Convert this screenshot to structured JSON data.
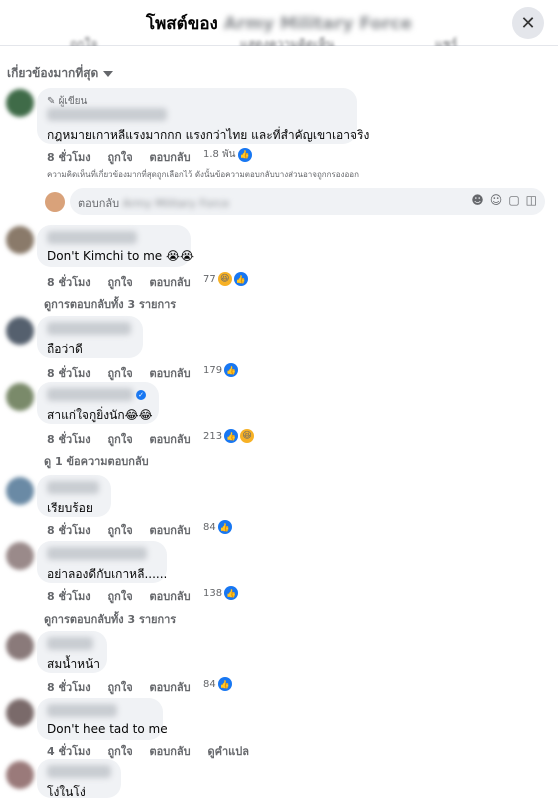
{
  "header": {
    "title": "โพสต์ของ",
    "page_name": "Army Military Force",
    "close_icon": "close-icon"
  },
  "actions": [
    "ถูกใจ",
    "แสดงความคิดเห็น",
    "แชร์"
  ],
  "sort": {
    "label": "เกี่ยวข้องมากที่สุด"
  },
  "top_comment": {
    "author_badge": "ผู้เขียน",
    "text": "กฎหมายเกาหลีแรงมากกก แรงกว่าไทย และที่สำคัญเขาเอาจริง",
    "time": "8 ชั่วโมง",
    "like": "ถูกใจ",
    "reply": "ตอบกลับ",
    "reactions": "1.8 พัน"
  },
  "note": "ความคิดเห็นที่เกี่ยวข้องมากที่สุดถูกเลือกไว้ ดังนั้นข้อความตอบกลับบางส่วนอาจถูกกรองออก",
  "reply_box": {
    "placeholder": "ตอบกลับ",
    "target": "Army Military Force"
  },
  "comments": [
    {
      "text": "Don't Kimchi to me 😭😭",
      "time": "8 ชั่วโมง",
      "like": "ถูกใจ",
      "reply": "ตอบกลับ",
      "reactions": "77",
      "view_replies": "ดูการตอบกลับทั้ง 3 รายการ"
    },
    {
      "text": "ถือว่าดี",
      "time": "8 ชั่วโมง",
      "like": "ถูกใจ",
      "reply": "ตอบกลับ",
      "reactions": "179"
    },
    {
      "text": "สาแก่ใจกูยิ่งนัก😂😂",
      "time": "8 ชั่วโมง",
      "like": "ถูกใจ",
      "reply": "ตอบกลับ",
      "reactions": "213",
      "view_replies": "ดู 1 ข้อความตอบกลับ"
    },
    {
      "text": "เรียบร้อย",
      "time": "8 ชั่วโมง",
      "like": "ถูกใจ",
      "reply": "ตอบกลับ",
      "reactions": "84"
    },
    {
      "text": "อย่าลองดีกับเกาหลี......",
      "time": "8 ชั่วโมง",
      "like": "ถูกใจ",
      "reply": "ตอบกลับ",
      "reactions": "138",
      "view_replies": "ดูการตอบกลับทั้ง 3 รายการ"
    },
    {
      "text": "สมน้ำหน้า",
      "time": "8 ชั่วโมง",
      "like": "ถูกใจ",
      "reply": "ตอบกลับ",
      "reactions": "84"
    },
    {
      "text": "Don't hee tad to me",
      "time": "4 ชั่วโมง",
      "like": "ถูกใจ",
      "reply": "ตอบกลับ",
      "translate": "ดูคำแปล"
    },
    {
      "text": "โง่ในโง่"
    }
  ],
  "colors": {
    "accent": "#1877f2",
    "bubble": "#f0f2f5",
    "muted": "#65676b"
  }
}
